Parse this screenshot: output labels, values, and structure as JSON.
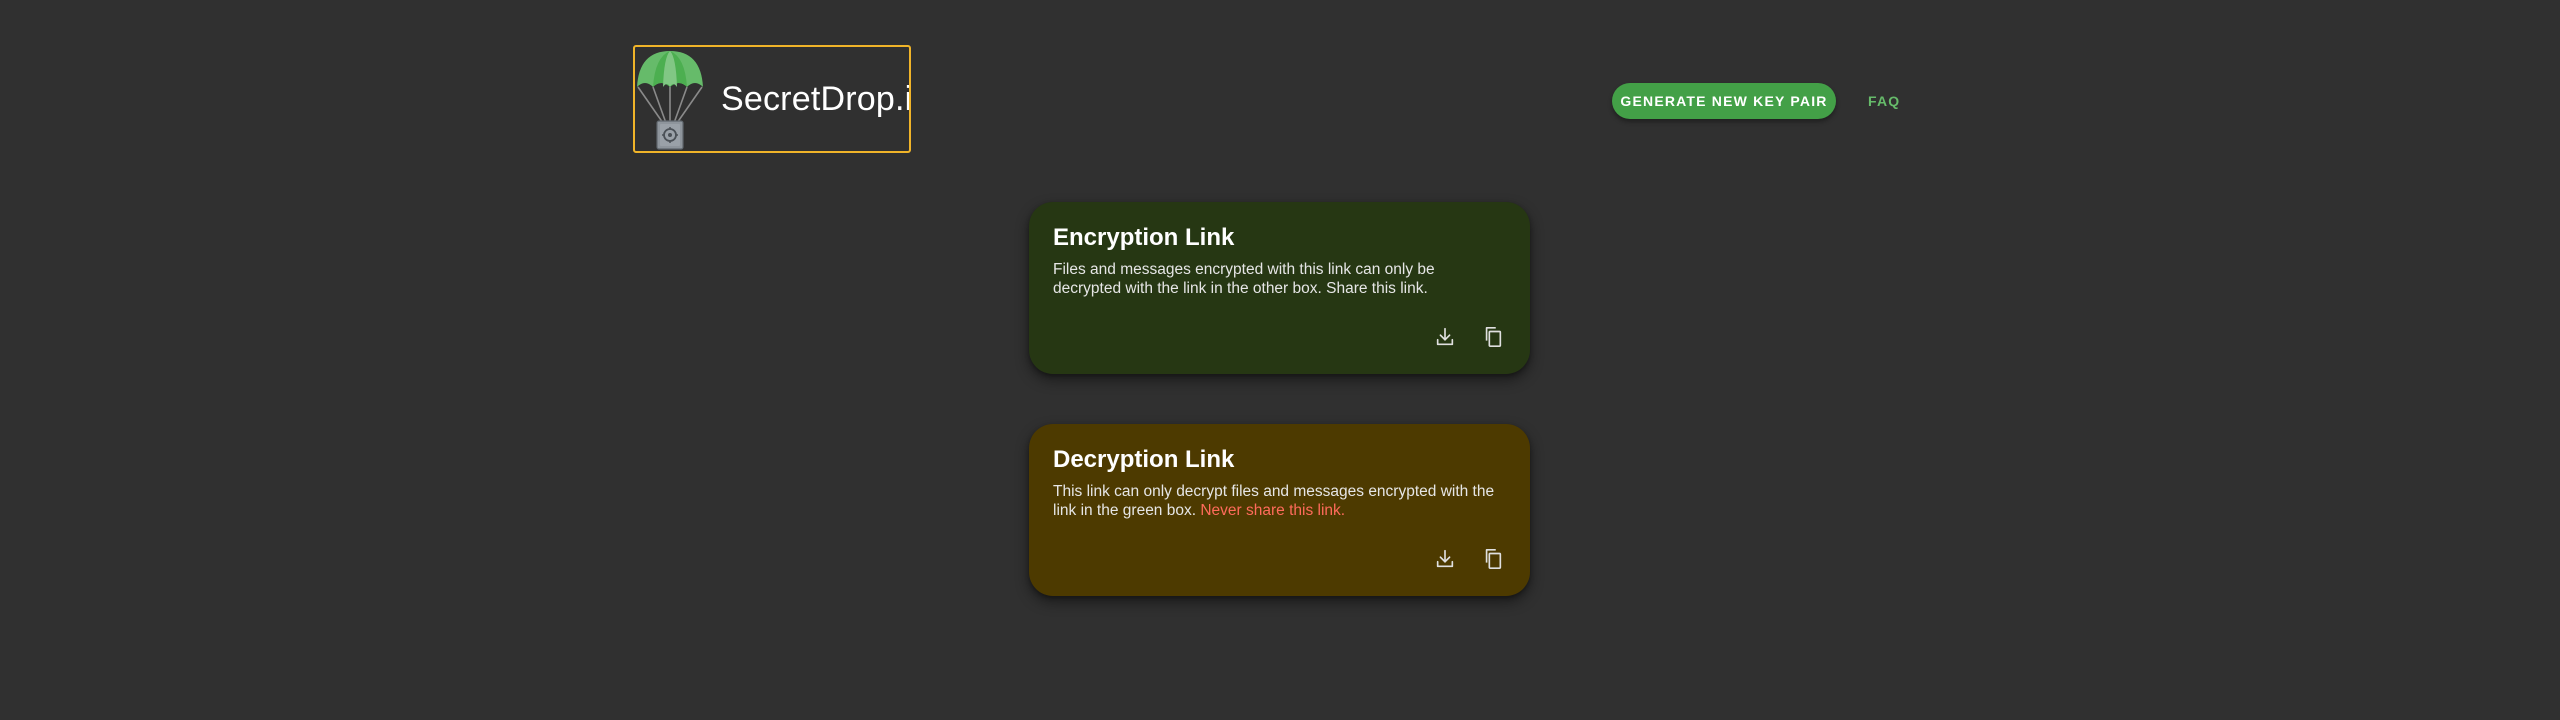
{
  "header": {
    "brand": "SecretDrop.io",
    "generate_button_label": "GENERATE NEW KEY PAIR",
    "faq_label": "FAQ"
  },
  "encryption_card": {
    "title": "Encryption Link",
    "body": "Files and messages encrypted with this link can only be decrypted with the link in the other box. Share this link."
  },
  "decryption_card": {
    "title": "Decryption Link",
    "body": "This link can only decrypt files and messages encrypted with the link in the green box. ",
    "warning": "Never share this link."
  },
  "icons": {
    "logo": "parachute-safe-icon",
    "download": "download-icon",
    "copy": "copy-icon"
  },
  "colors": {
    "background": "#303030",
    "accent_green": "#43a047",
    "faq_green": "#66bb6a",
    "logo_border": "#f0b429",
    "encryption_card_bg": "#263713",
    "decryption_card_bg": "#4d3a00",
    "warning_text": "#ff6b5b"
  }
}
